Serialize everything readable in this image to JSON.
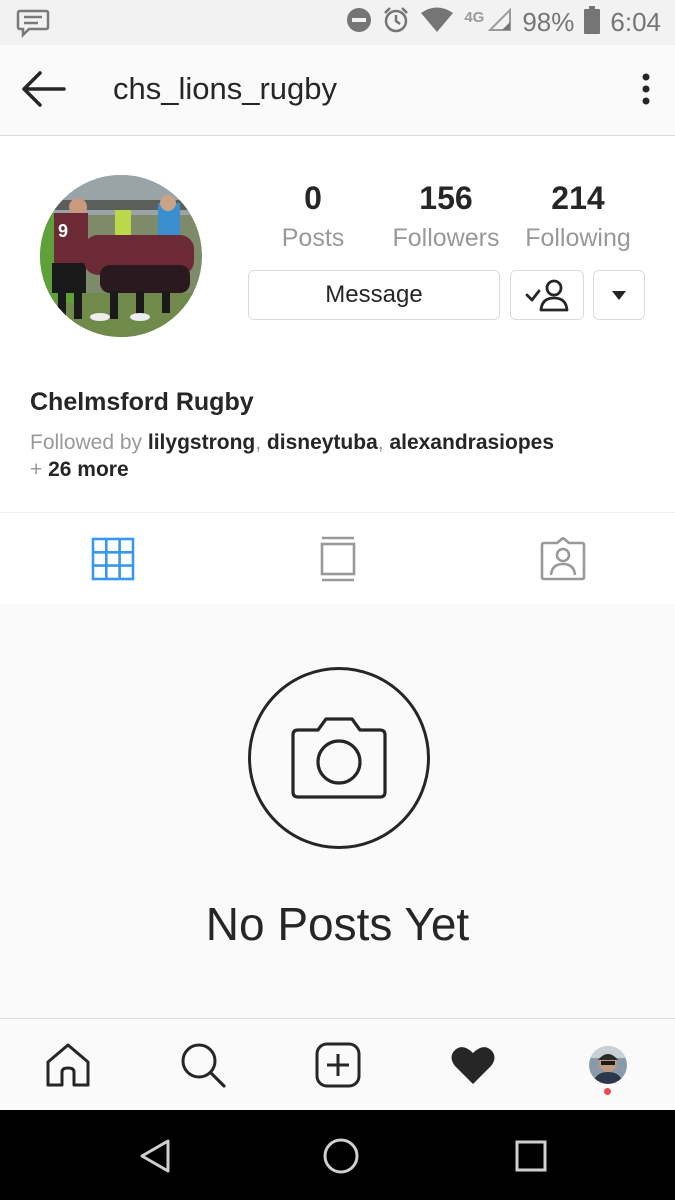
{
  "status_bar": {
    "network": "4G",
    "battery": "98%",
    "time": "6:04"
  },
  "header": {
    "username": "chs_lions_rugby"
  },
  "profile": {
    "stats": [
      {
        "value": "0",
        "label": "Posts"
      },
      {
        "value": "156",
        "label": "Followers"
      },
      {
        "value": "214",
        "label": "Following"
      }
    ],
    "message_label": "Message",
    "display_name": "Chelmsford Rugby",
    "followed_by_prefix": "Followed by ",
    "followers_shown": [
      "lilygstrong",
      "disneytuba",
      "alexandrasiopes"
    ],
    "separator": ", ",
    "more_prefix": "+ ",
    "more_text": "26 more"
  },
  "tabs": [
    {
      "icon": "grid-icon",
      "active": true
    },
    {
      "icon": "feed-icon",
      "active": false
    },
    {
      "icon": "tagged-icon",
      "active": false
    }
  ],
  "empty_state": {
    "icon": "camera-icon",
    "title": "No Posts Yet"
  },
  "bottom_nav": [
    {
      "icon": "home-icon"
    },
    {
      "icon": "search-icon"
    },
    {
      "icon": "add-post-icon"
    },
    {
      "icon": "heart-icon"
    },
    {
      "icon": "profile-icon"
    }
  ],
  "colors": {
    "accent": "#3897f0",
    "text": "#262626",
    "muted": "#999999",
    "notification": "#ed4956"
  }
}
